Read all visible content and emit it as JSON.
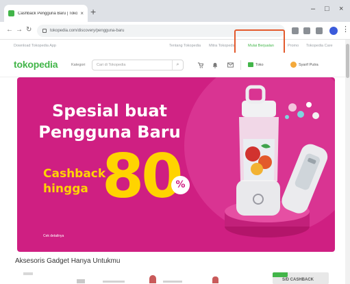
{
  "browser": {
    "tab_title": "Cashback Pengguna Baru | Tokopedia",
    "tab_close": "×",
    "new_tab": "+",
    "window_controls": {
      "minimize": "–",
      "maximize": "□",
      "close": "×"
    },
    "nav": {
      "back": "←",
      "forward": "→",
      "reload": "↻"
    },
    "url": "tokopedia.com/discovery/pengguna-baru",
    "menu": "⋮"
  },
  "topbar": {
    "download_text": "Download Tokopedia App",
    "links": [
      "Tentang Tokopedia",
      "Mitra Tokopedia",
      "Mulai Berjualan",
      "Promo",
      "Tokopedia Care"
    ],
    "active_link_index": 2
  },
  "header": {
    "logo": "tokopedia",
    "kategori": "Kategori",
    "search_placeholder": "Cari di Tokopedia",
    "search_icon": "⌕",
    "cart_icon": "🛒",
    "bell_icon": "🔔",
    "mail_icon": "✉",
    "toko_label": "Toko",
    "account_label": "Syarif Putra"
  },
  "banner": {
    "headline": [
      "Spesial buat",
      "Pengguna Baru"
    ],
    "cashback": [
      "Cashback",
      "hingga"
    ],
    "amount": "80",
    "percent": "%",
    "small_link": "Cek detailnya",
    "colors": {
      "bg": "#cf1f82",
      "accent": "#ffd400"
    }
  },
  "section": {
    "title": "Aksesoris Gadget Hanya Untukmu",
    "promo_text": "S/D CASHBACK"
  },
  "accent_colors": {
    "brand_green": "#42b549",
    "highlight": "#e3592c"
  }
}
